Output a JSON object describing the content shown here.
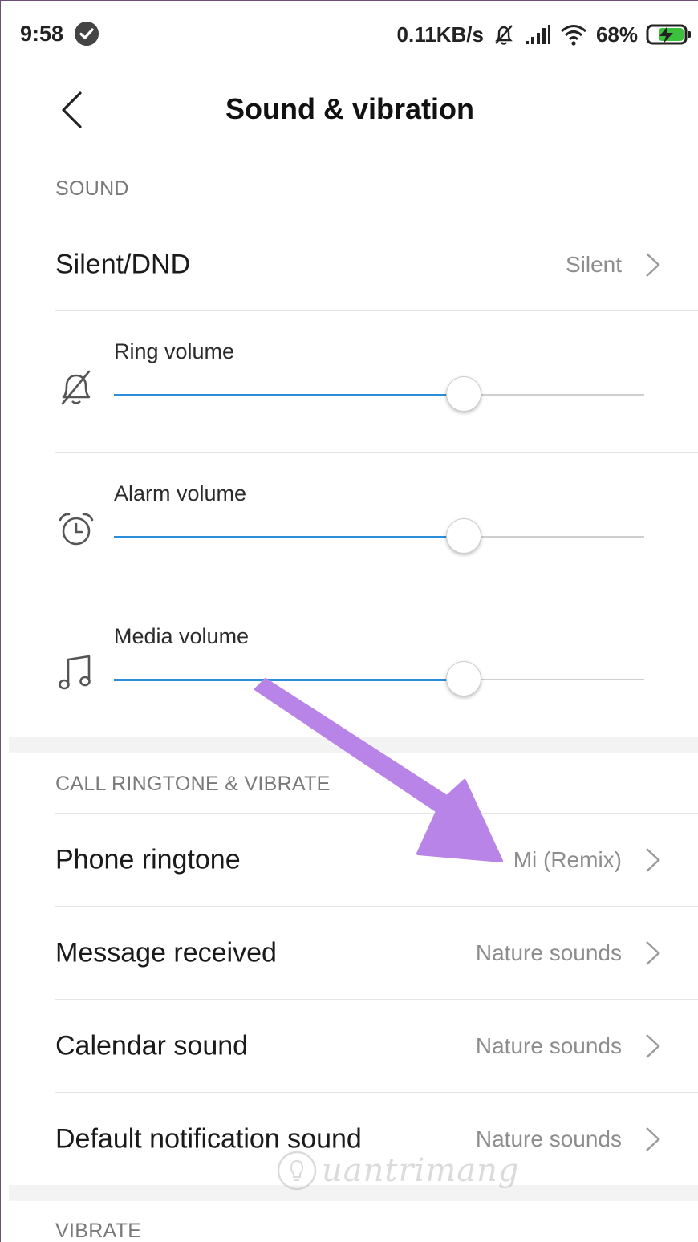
{
  "status_bar": {
    "time": "9:58",
    "network_speed": "0.11KB/s",
    "battery_percent": "68%",
    "icons": [
      "check-circle-icon",
      "mute-bell-icon",
      "signal-icon",
      "wifi-icon",
      "battery-charging-icon"
    ]
  },
  "header": {
    "title": "Sound & vibration",
    "back_icon": "back-chevron-icon"
  },
  "sections": {
    "sound": {
      "label": "SOUND",
      "silent_dnd": {
        "title": "Silent/DND",
        "value": "Silent"
      },
      "ring_volume": {
        "label": "Ring volume",
        "icon": "bell-off-icon",
        "level": 0.66
      },
      "alarm_volume": {
        "label": "Alarm volume",
        "icon": "alarm-clock-icon",
        "level": 0.66
      },
      "media_volume": {
        "label": "Media volume",
        "icon": "music-note-icon",
        "level": 0.66
      }
    },
    "ringtone": {
      "label": "CALL RINGTONE & VIBRATE",
      "items": [
        {
          "title": "Phone ringtone",
          "value": "Mi (Remix)"
        },
        {
          "title": "Message received",
          "value": "Nature sounds"
        },
        {
          "title": "Calendar sound",
          "value": "Nature sounds"
        },
        {
          "title": "Default notification sound",
          "value": "Nature sounds"
        }
      ]
    },
    "vibrate": {
      "label": "VIBRATE"
    }
  },
  "annotation": {
    "arrow_color": "#b884e8"
  },
  "watermark": {
    "text": "uantrimang",
    "icon": "lightbulb-icon"
  },
  "colors": {
    "accent": "#2a8fd8",
    "track": "#cfcfcf"
  }
}
